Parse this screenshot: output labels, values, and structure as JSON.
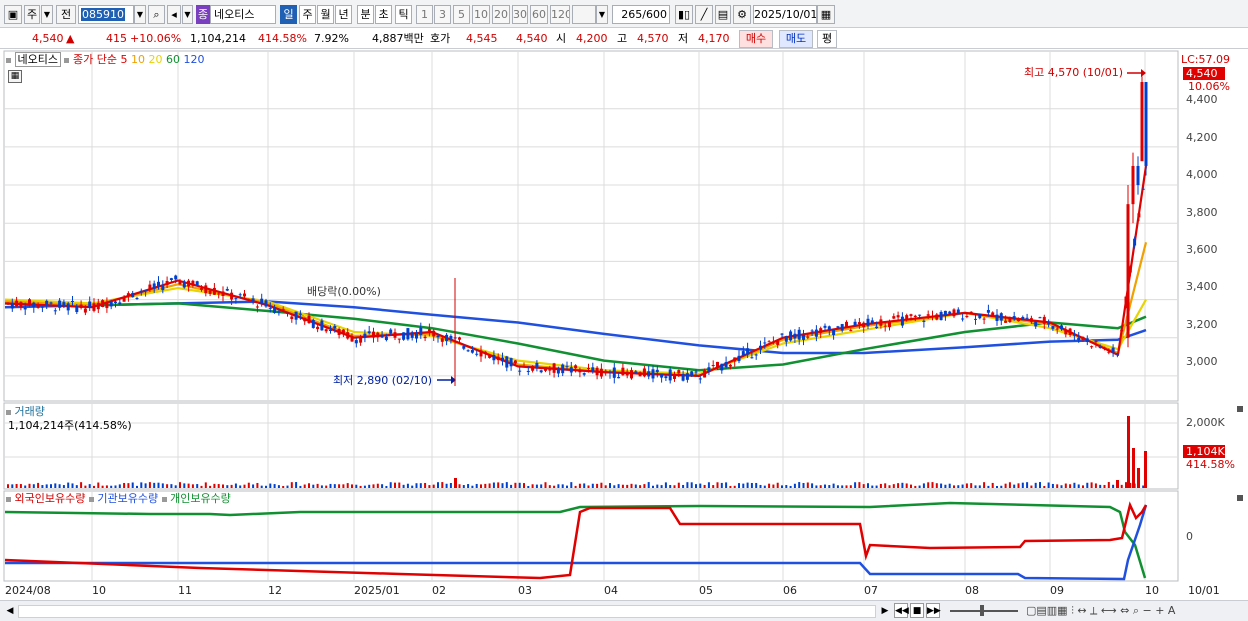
{
  "toolbar": {
    "market": "주",
    "prev": "전",
    "code": "085910",
    "badge": "종",
    "stock_name": "네오티스",
    "periods": [
      "일",
      "주",
      "월",
      "년",
      "분",
      "초",
      "틱"
    ],
    "active_period": "일",
    "intervals": [
      "1",
      "3",
      "5",
      "10",
      "20",
      "30",
      "60",
      "120"
    ],
    "count": "265",
    "count_total": "/600",
    "date": "2025/10/01"
  },
  "quote": {
    "price": "4,540",
    "change": "415",
    "change_pct": "+10.06%",
    "volume": "1,104,214",
    "vol_ratio": "414.58%",
    "turnover": "7.92%",
    "amount": "4,887백만",
    "bid_label": "호가",
    "ask": "4,545",
    "bid": "4,540",
    "open_label": "시",
    "open": "4,200",
    "high_label": "고",
    "high": "4,570",
    "low_label": "저",
    "low": "4,170",
    "buy": "매수",
    "sell": "매도",
    "avg": "평"
  },
  "price_legend": {
    "name": "네오티스",
    "ma_label": "종가 단순",
    "ma": [
      "5",
      "10",
      "20",
      "60",
      "120"
    ],
    "ma_colors": [
      "#e00000",
      "#f0a000",
      "#e8d400",
      "#109030",
      "#2050e0"
    ]
  },
  "price_axis": {
    "lc": "LC:57.09",
    "cur": "4,540",
    "cur_pct": "10.06%",
    "ticks": [
      "4,400",
      "4,200",
      "4,000",
      "3,800",
      "3,600",
      "3,400",
      "3,200",
      "3,000"
    ]
  },
  "annotations": {
    "high": "최고 4,570 (10/01)",
    "low": "최저 2,890 (02/10)",
    "dividend": "배당락(0.00%)"
  },
  "volume": {
    "title": "거래량",
    "value": "1,104,214주(414.58%)",
    "tick": "2,000K",
    "cur": "1,104K",
    "cur_pct": "414.58%"
  },
  "holdings": {
    "foreign": "외국인보유수량",
    "institution": "기관보유수량",
    "individual": "개인보유수량",
    "tick": "0"
  },
  "x_axis": [
    "2024/08",
    "10",
    "11",
    "12",
    "2025/01",
    "02",
    "03",
    "04",
    "05",
    "06",
    "07",
    "08",
    "09",
    "10",
    "10/01"
  ],
  "colors": {
    "up": "#e00000",
    "down": "#0040d0",
    "grid": "#dcdcdc",
    "highlight": "#e00000"
  },
  "chart_data": {
    "type": "line",
    "x": [
      "2024-08",
      "2024-09",
      "2024-10",
      "2024-11",
      "2024-12",
      "2025-01",
      "2025-02",
      "2025-03",
      "2025-04",
      "2025-05",
      "2025-06",
      "2025-07",
      "2025-08",
      "2025-09",
      "2025-10"
    ],
    "series": [
      {
        "name": "5",
        "values": [
          3380,
          3360,
          3500,
          3370,
          3200,
          3230,
          3050,
          3020,
          3000,
          3200,
          3270,
          3330,
          3280,
          3110,
          4100
        ]
      },
      {
        "name": "10",
        "values": [
          3390,
          3370,
          3480,
          3380,
          3210,
          3220,
          3060,
          3020,
          3000,
          3190,
          3260,
          3330,
          3270,
          3120,
          3700
        ]
      },
      {
        "name": "20",
        "values": [
          3400,
          3380,
          3460,
          3390,
          3230,
          3210,
          3080,
          3030,
          3010,
          3170,
          3240,
          3330,
          3250,
          3140,
          3400
        ]
      },
      {
        "name": "60",
        "values": [
          3380,
          3370,
          3380,
          3340,
          3300,
          3250,
          3170,
          3080,
          3030,
          3060,
          3140,
          3230,
          3280,
          3250,
          3310
        ]
      },
      {
        "name": "120",
        "values": [
          3360,
          3370,
          3380,
          3390,
          3360,
          3320,
          3280,
          3220,
          3160,
          3120,
          3120,
          3150,
          3180,
          3190,
          3240
        ]
      }
    ],
    "ylim": [
      2900,
      4650
    ]
  }
}
